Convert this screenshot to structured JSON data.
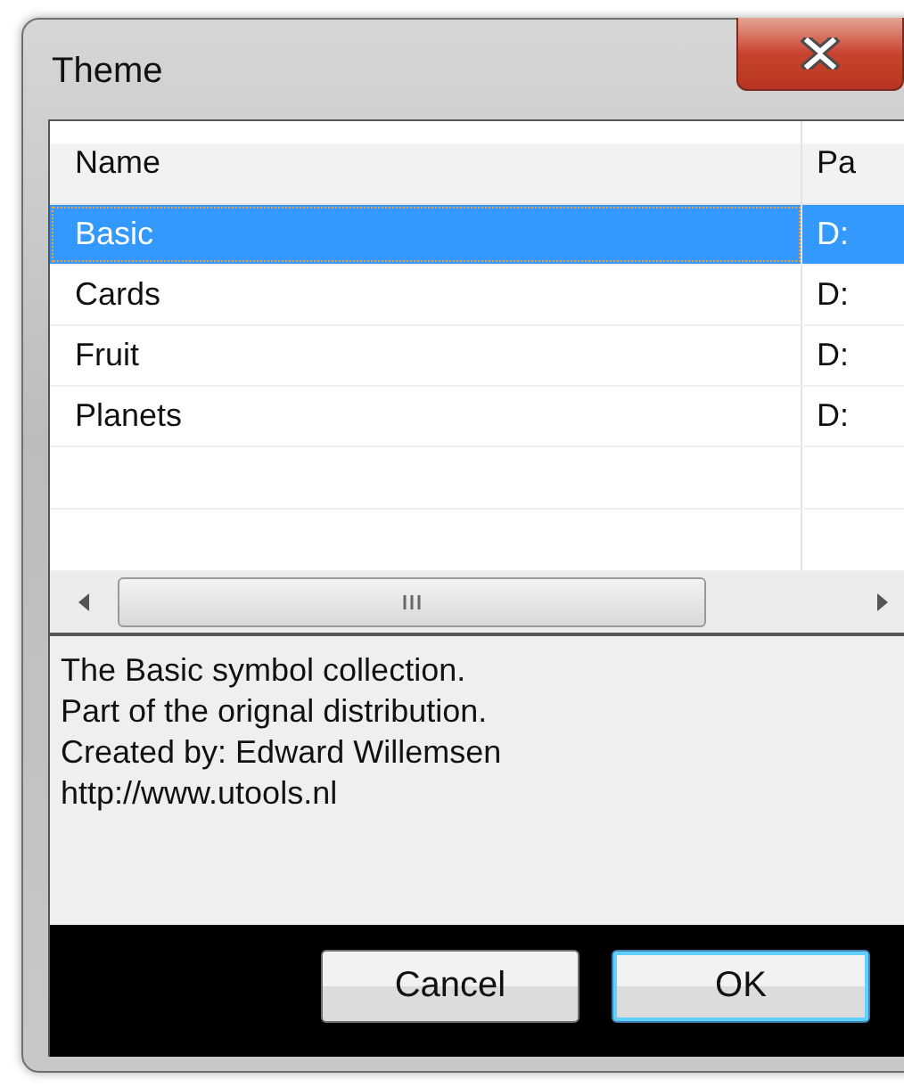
{
  "window": {
    "title": "Theme"
  },
  "table": {
    "columns": [
      "Name",
      "Pa"
    ],
    "rows": [
      {
        "name": "Basic",
        "path": "D:",
        "selected": true
      },
      {
        "name": "Cards",
        "path": "D:",
        "selected": false
      },
      {
        "name": "Fruit",
        "path": "D:",
        "selected": false
      },
      {
        "name": "Planets",
        "path": "D:",
        "selected": false
      }
    ]
  },
  "description": [
    "The Basic symbol collection.",
    "Part of the orignal distribution.",
    "Created by: Edward Willemsen",
    "http://www.utools.nl"
  ],
  "buttons": [
    {
      "label": "Cancel",
      "default": false
    },
    {
      "label": "OK",
      "default": true
    }
  ]
}
